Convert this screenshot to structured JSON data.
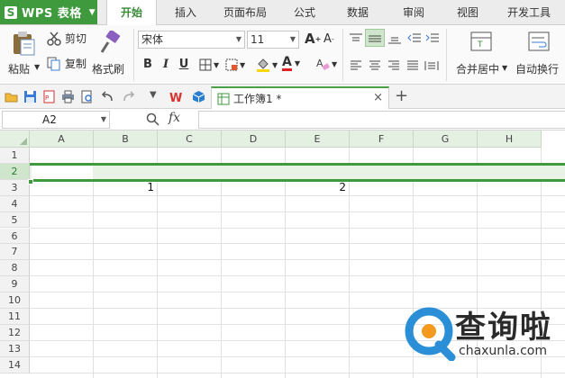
{
  "app": {
    "name": "WPS 表格",
    "logo_letter": "S"
  },
  "menu": {
    "tabs": [
      "开始",
      "插入",
      "页面布局",
      "公式",
      "数据",
      "审阅",
      "视图",
      "开发工具"
    ],
    "active": "开始"
  },
  "ribbon": {
    "paste": "粘贴",
    "cut": "剪切",
    "copy": "复制",
    "format_painter": "格式刷",
    "font_name": "宋体",
    "font_size": "11",
    "merge_center": "合并居中",
    "auto_wrap": "自动换行",
    "bold": "B",
    "italic": "I",
    "underline": "U",
    "font_color_glyph": "A"
  },
  "document": {
    "tab_title": "工作簿1 *",
    "close_glyph": "×",
    "new_tab_glyph": "+"
  },
  "formula_bar": {
    "cell_ref": "A2",
    "fx": "fx",
    "value": ""
  },
  "sheet": {
    "columns": [
      "A",
      "B",
      "C",
      "D",
      "E",
      "F",
      "G",
      "H"
    ],
    "rows": [
      "1",
      "2",
      "3",
      "4",
      "5",
      "6",
      "7",
      "8",
      "9",
      "10",
      "11",
      "12",
      "13",
      "14"
    ],
    "selected_row": "2",
    "cells": [
      {
        "ref": "B3",
        "value": "1"
      },
      {
        "ref": "E3",
        "value": "2"
      }
    ]
  },
  "watermark": {
    "title": "查询啦",
    "url": "chaxunla.com"
  },
  "colors": {
    "accent": "#3f9a3d",
    "selection_border": "#3f9a3d",
    "header_green": "#e4f0e2",
    "watermark_blue": "#2b8fd8",
    "watermark_orange": "#f39a1e"
  }
}
